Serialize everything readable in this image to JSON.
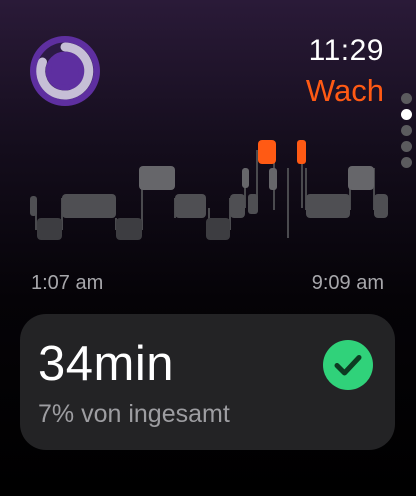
{
  "header": {
    "time": "11:29",
    "stage_label": "Wach",
    "app_icon": "sleep-ring-icon"
  },
  "pagination": {
    "total_pages": 5,
    "active_index": 1
  },
  "sleep_timeline": {
    "start_time": "1:07 am",
    "end_time": "9:09 am",
    "highlighted_stage": "Wach"
  },
  "summary_card": {
    "duration": "34min",
    "percent_text": "7% von ingesamt",
    "status_icon": "checkmark-circle-icon"
  },
  "colors": {
    "accent_awake": "#ff5a14",
    "ring_purple": "#5e2fa0",
    "check_green": "#30d27a",
    "card_bg": "#232325",
    "stage_gray": "#58585c"
  }
}
